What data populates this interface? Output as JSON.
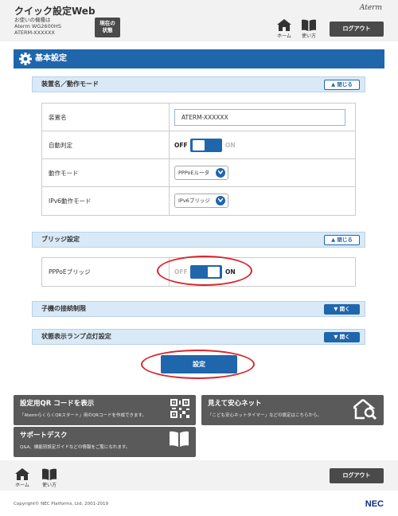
{
  "header": {
    "title": "クイック設定Web",
    "device_line1": "お使いの機種は",
    "device_line2": "Aterm WG2600HS",
    "device_line3": "ATERM-XXXXXX",
    "current_status_line1": "現在の",
    "current_status_line2": "状態",
    "brand": "Aterm",
    "home_label": "ホーム",
    "howto_label": "使い方",
    "logout_label": "ログアウト"
  },
  "main": {
    "title": "基本設定"
  },
  "section_device": {
    "title": "装置名／動作モード",
    "toggle_label": "閉じる",
    "rows": [
      {
        "label": "装置名",
        "value": "ATERM-XXXXXX"
      },
      {
        "label": "自動判定",
        "off": "OFF",
        "on": "ON"
      },
      {
        "label": "動作モード",
        "value": "PPPoEルータ"
      },
      {
        "label": "IPv6動作モード",
        "value": "IPv6ブリッジ"
      }
    ]
  },
  "section_bridge": {
    "title": "ブリッジ設定",
    "toggle_label": "閉じる",
    "row": {
      "label": "PPPoEブリッジ",
      "off": "OFF",
      "on": "ON"
    }
  },
  "section_child": {
    "title": "子機の接続制限",
    "toggle_label": "開く"
  },
  "section_lamp": {
    "title": "状態表示ランプ点灯設定",
    "toggle_label": "開く"
  },
  "submit_label": "設定",
  "tiles": {
    "qr": {
      "title": "設定用QR コードを表示",
      "desc": "「AtermらくらくQRスタート」用のQRコードを作成できます。"
    },
    "safe": {
      "title": "見えて安心ネット",
      "desc": "「こども安心ネットタイマー」などの設定はこちらから。"
    },
    "support": {
      "title": "サポートデスク",
      "desc": "Q&A、機能別設定ガイドなどの情報をご覧になれます。"
    }
  },
  "footer": {
    "home_label": "ホーム",
    "howto_label": "使い方",
    "logout_label": "ログアウト",
    "copyright": "Copyright© NEC Platforms, Ltd. 2001-2019",
    "brand": "NEC"
  },
  "colors": {
    "accent": "#1f66ad",
    "section_bg": "#d9e9f7",
    "dark_button": "#4a4a4a",
    "highlight": "#d8262b"
  }
}
